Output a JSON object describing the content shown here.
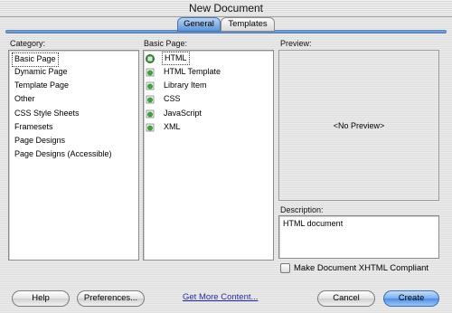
{
  "window": {
    "title": "New Document"
  },
  "tabs": [
    {
      "label": "General",
      "selected": true
    },
    {
      "label": "Templates",
      "selected": false
    }
  ],
  "category": {
    "label": "Category:",
    "items": [
      "Basic Page",
      "Dynamic Page",
      "Template Page",
      "Other",
      "CSS Style Sheets",
      "Framesets",
      "Page Designs",
      "Page Designs (Accessible)"
    ],
    "selected": "Basic Page"
  },
  "basic_page": {
    "label": "Basic Page:",
    "items": [
      {
        "label": "HTML",
        "icon": "html-document-icon"
      },
      {
        "label": "HTML Template",
        "icon": "document-icon"
      },
      {
        "label": "Library Item",
        "icon": "document-icon"
      },
      {
        "label": "CSS",
        "icon": "document-icon"
      },
      {
        "label": "JavaScript",
        "icon": "document-icon"
      },
      {
        "label": "XML",
        "icon": "document-icon"
      }
    ],
    "selected": "HTML"
  },
  "preview": {
    "label": "Preview:",
    "placeholder": "<No Preview>"
  },
  "description": {
    "label": "Description:",
    "text": "HTML document"
  },
  "xhtml_checkbox": {
    "label": "Make Document XHTML Compliant",
    "checked": false
  },
  "buttons": {
    "help": "Help",
    "preferences": "Preferences...",
    "get_more": "Get More Content...",
    "cancel": "Cancel",
    "create": "Create"
  },
  "colors": {
    "accent": "#5d95d8",
    "link": "#2a2aa6"
  }
}
